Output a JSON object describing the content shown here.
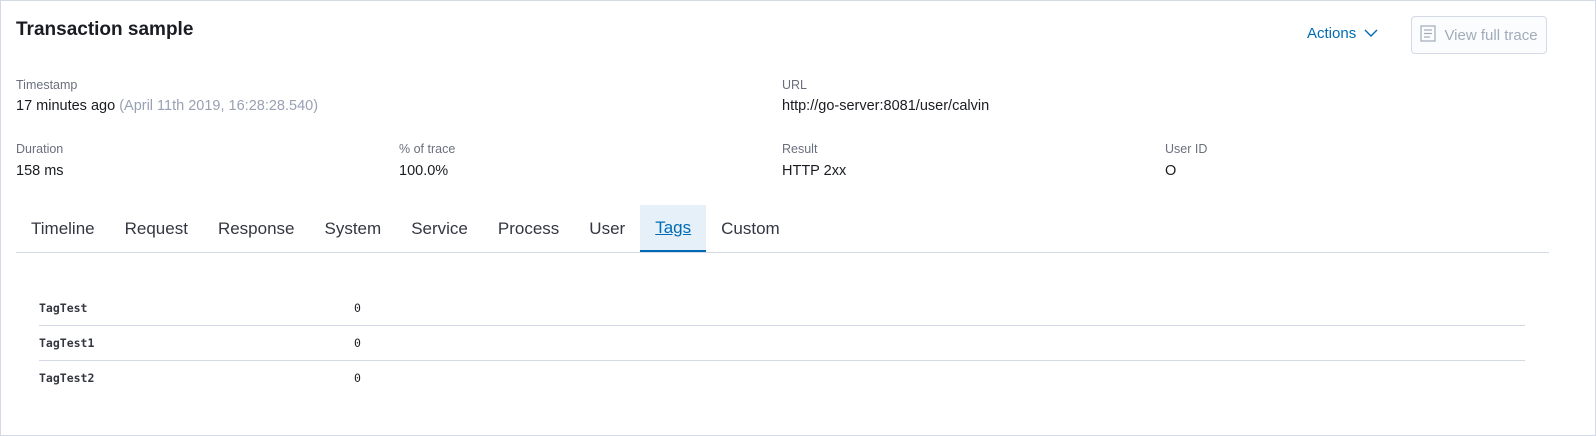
{
  "header": {
    "title": "Transaction sample",
    "actions_label": "Actions",
    "view_trace_label": "View full trace"
  },
  "summary": {
    "timestamp": {
      "label": "Timestamp",
      "relative": "17 minutes ago",
      "absolute": "(April 11th 2019, 16:28:28.540)"
    },
    "url": {
      "label": "URL",
      "value": "http://go-server:8081/user/calvin"
    },
    "duration": {
      "label": "Duration",
      "value": "158 ms"
    },
    "percent_of_trace": {
      "label": "% of trace",
      "value": "100.0%"
    },
    "result": {
      "label": "Result",
      "value": "HTTP 2xx"
    },
    "user_id": {
      "label": "User ID",
      "value": "O"
    }
  },
  "tabs": [
    {
      "label": "Timeline"
    },
    {
      "label": "Request"
    },
    {
      "label": "Response"
    },
    {
      "label": "System"
    },
    {
      "label": "Service"
    },
    {
      "label": "Process"
    },
    {
      "label": "User"
    },
    {
      "label": "Tags",
      "active": true
    },
    {
      "label": "Custom"
    }
  ],
  "tags": [
    {
      "key": "TagTest",
      "value": "0"
    },
    {
      "key": "TagTest1",
      "value": "0"
    },
    {
      "key": "TagTest2",
      "value": "0"
    }
  ],
  "colors": {
    "accent": "#006bb4",
    "active_tab_bg": "#e6f0f8",
    "border": "#d3dae6"
  }
}
